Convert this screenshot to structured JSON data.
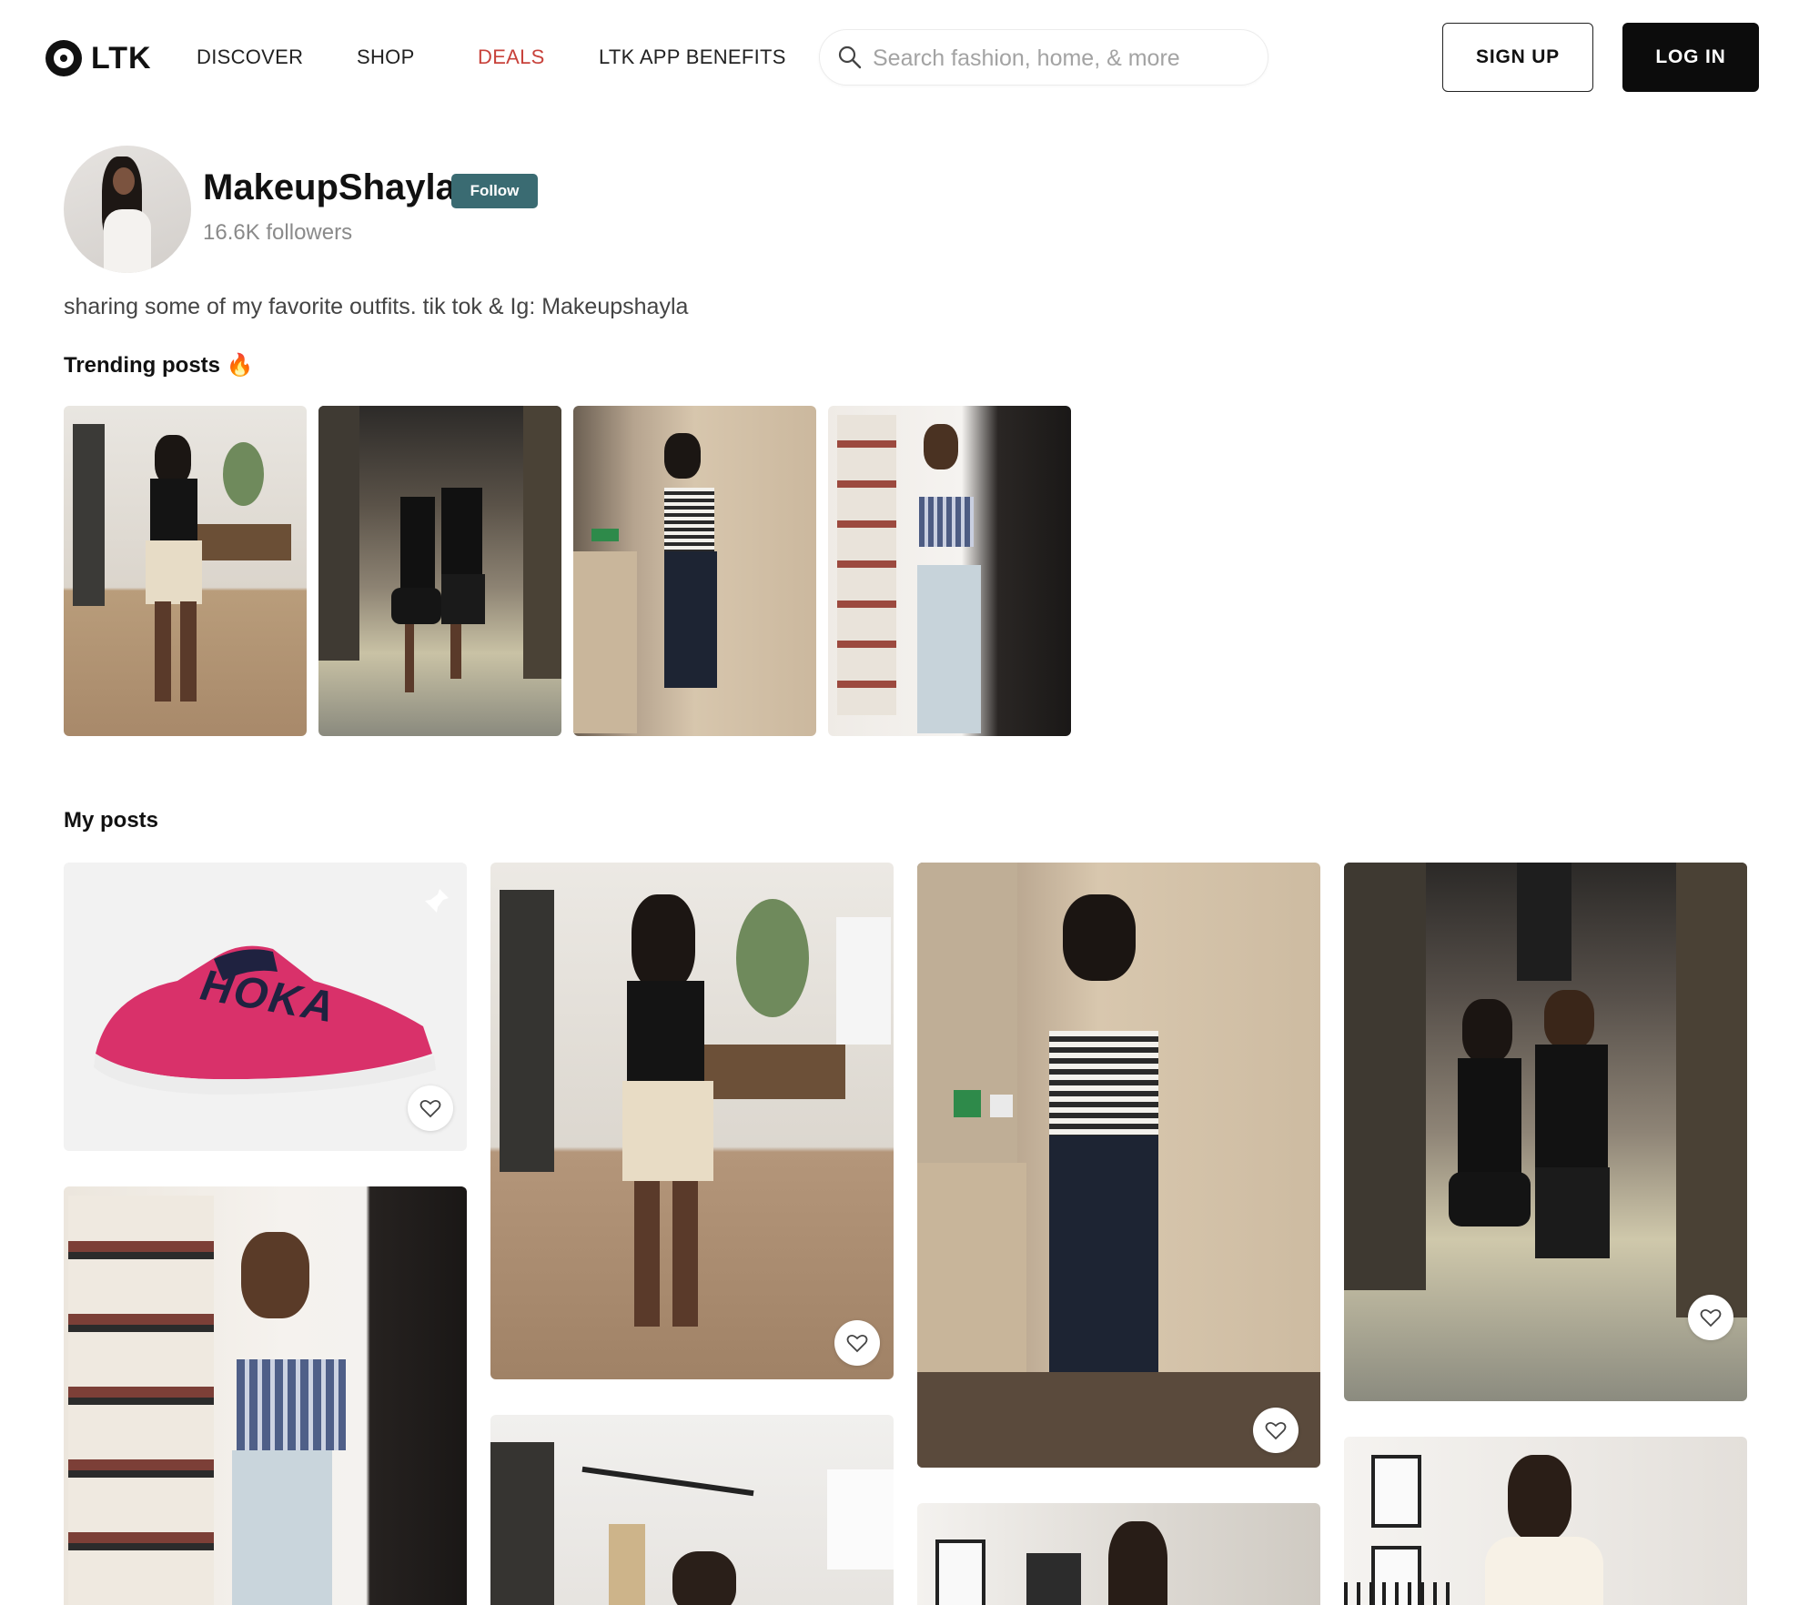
{
  "header": {
    "logo_text": "LTK",
    "nav": [
      "DISCOVER",
      "SHOP",
      "DEALS",
      "LTK APP BENEFITS"
    ],
    "search_placeholder": "Search fashion, home, & more",
    "signup_label": "SIGN UP",
    "login_label": "LOG IN"
  },
  "profile": {
    "name": "MakeupShayla",
    "follow_label": "Follow",
    "followers": "16.6K followers",
    "bio": "sharing some of my favorite outfits. tik tok & Ig: Makeupshayla"
  },
  "sections": {
    "trending": "Trending posts 🔥",
    "my_posts": "My posts"
  },
  "shoe_brand_text": "HOKA",
  "colors": {
    "deals": "#c8423b",
    "follow_button": "#3a6b72",
    "login_button": "#0c0c0c",
    "shoe_pink": "#d9316a"
  }
}
